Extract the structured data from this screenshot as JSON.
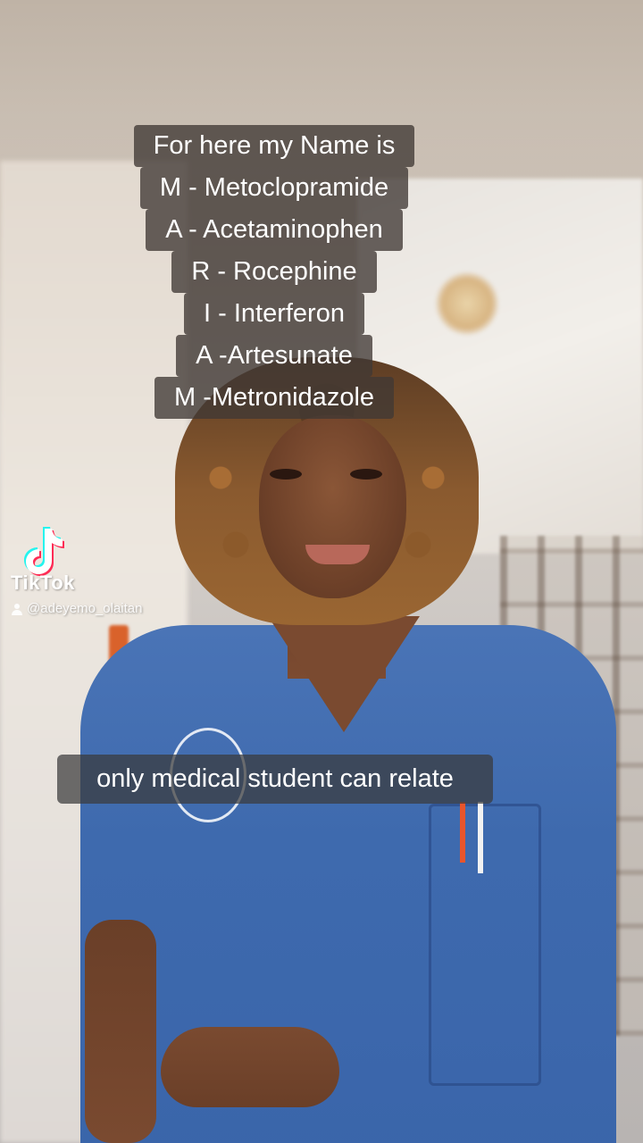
{
  "overlay": {
    "name_lines": [
      "For here my Name is",
      "M - Metoclopramide",
      "A - Acetaminophen",
      "R - Rocephine",
      "I - Interferon",
      "A -Artesunate",
      "M -Metronidazole"
    ],
    "caption": "only medical student can relate"
  },
  "watermark": {
    "brand": "TikTok",
    "username": "@adeyemo_olaitan",
    "icon": "tiktok-note-icon"
  },
  "colors": {
    "text_box_bg": "#403834",
    "scrubs": "#3e6aae",
    "text": "#ffffff"
  }
}
